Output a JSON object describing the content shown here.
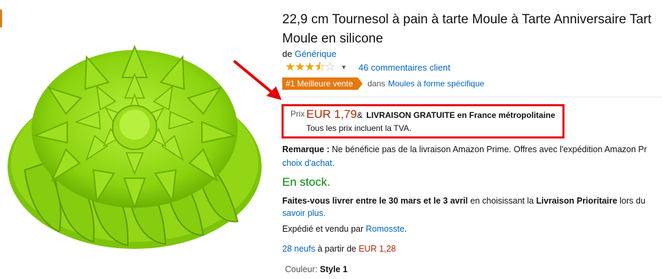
{
  "product": {
    "title_line1": "22,9 cm Tournesol à pain à tarte Moule à Tarte Anniversaire Tart",
    "title_line2": "Moule en silicone",
    "by_prefix": "de",
    "brand": "Générique",
    "rating": {
      "stars": 3.5,
      "max": 5,
      "reviews_text": "46 commentaires client"
    },
    "bestseller": {
      "badge": "#1 Meilleure vente",
      "in_text": "dans",
      "category": "Moules à forme spécifique"
    },
    "price": {
      "label": "Prix :",
      "value": "EUR 1,79",
      "amp": "&",
      "free_delivery": "LIVRAISON GRATUITE en France métropolitaine",
      "tva_note": "Tous les prix incluent la TVA."
    },
    "remark": {
      "label": "Remarque :",
      "text": "Ne bénéficie pas de la livraison Amazon Prime. Offres avec l'expédition Amazon Pr",
      "link": "choix d'achat."
    },
    "stock": "En stock.",
    "delivery": {
      "bold1": "Faites-vous livrer entre le 30 mars et le 3 avril",
      "mid": "en choisissant la",
      "bold2": "Livraison Prioritaire",
      "tail": "lors du",
      "link": "savoir plus."
    },
    "sold_by": {
      "prefix": "Expédié et vendu par",
      "seller": "Romosste",
      "suffix": "."
    },
    "offers": {
      "link": "28 neufs",
      "mid": "à partir de",
      "price": "EUR 1,28"
    },
    "color": {
      "label": "Couleur:",
      "value": "Style 1"
    }
  },
  "colors": {
    "link": "#0066c0",
    "price": "#b12704",
    "stock": "#008a00",
    "badge": "#e47911",
    "highlight": "#e60000",
    "product": "#8fd80f"
  }
}
